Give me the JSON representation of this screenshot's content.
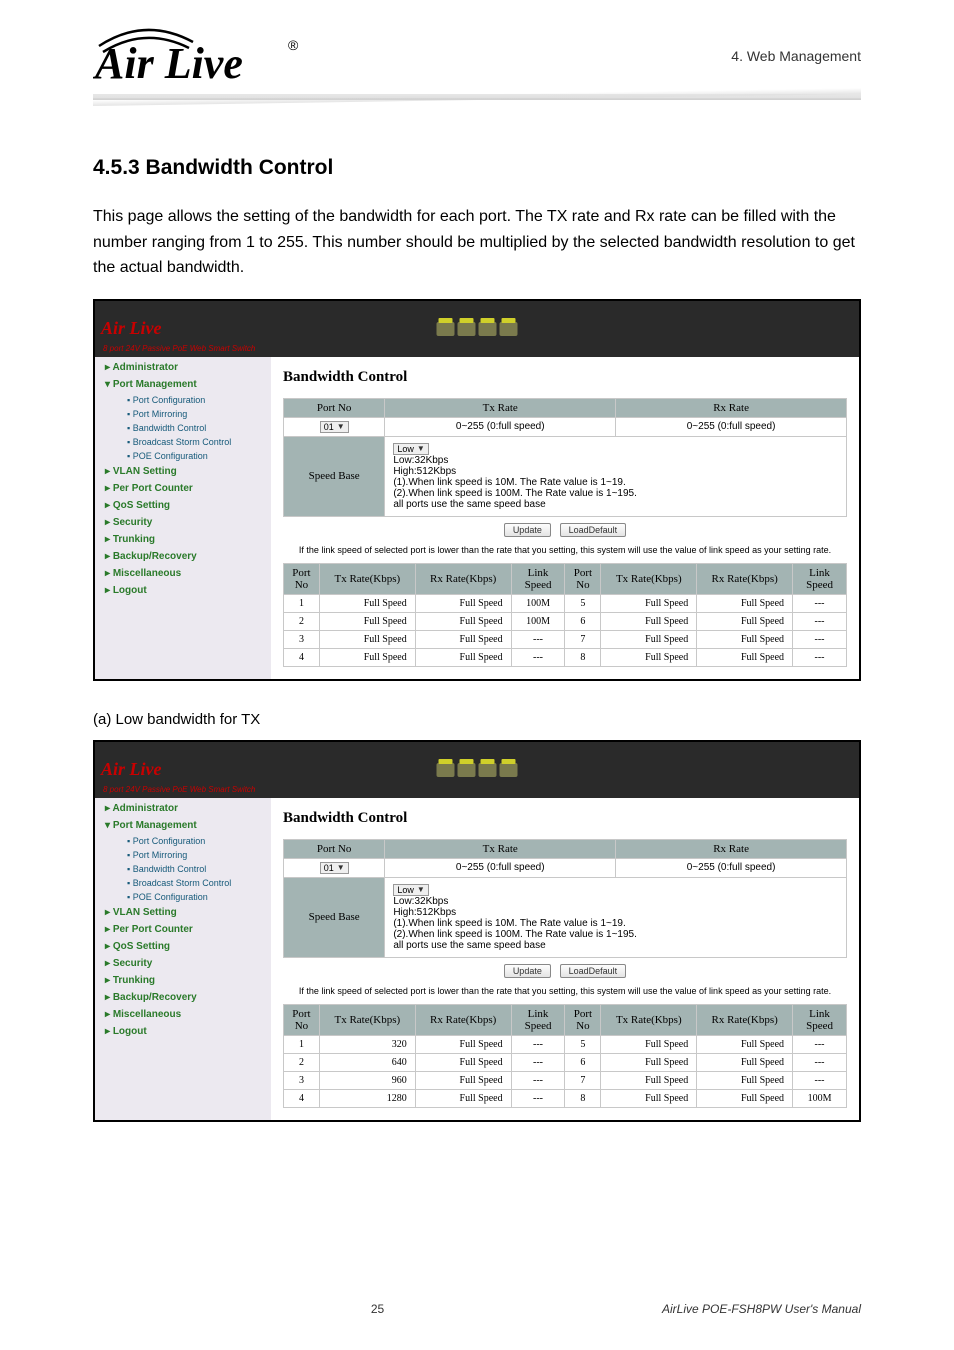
{
  "header": {
    "chapter": "4.  Web Management",
    "logo_text_air": "Air",
    "logo_text_live": "Live",
    "logo_reg": "®"
  },
  "section": {
    "number_title": "4.5.3 Bandwidth Control",
    "body": "This page allows the setting of the bandwidth for each port. The TX rate and Rx rate can be filled with the number ranging from 1 to 255. This number should be multiplied by the selected bandwidth resolution to get the actual bandwidth."
  },
  "shot_common": {
    "brand_text": "Air Live",
    "brand_sub": "8 port 24V Passive PoE Web Smart Switch",
    "panel_title": "Bandwidth Control",
    "nav": {
      "administrator": "Administrator",
      "port_management": "Port Management",
      "items": [
        "Port Configuration",
        "Port Mirroring",
        "Bandwidth Control",
        "Broadcast Storm Control",
        "POE Configuration"
      ],
      "rest": [
        "VLAN Setting",
        "Per Port Counter",
        "QoS Setting",
        "Security",
        "Trunking",
        "Backup/Recovery",
        "Miscellaneous",
        "Logout"
      ]
    },
    "config": {
      "port_no": "Port No",
      "tx_rate": "Tx Rate",
      "rx_rate": "Rx Rate",
      "port_select": "01",
      "range_text": "0~255 (0:full speed)",
      "speed_base_label": "Speed Base",
      "speed_base_select": "Low",
      "low_line": "Low:32Kbps",
      "high_line": "High:512Kbps",
      "rule1": "(1).When link speed is 10M. The Rate value is 1~19.",
      "rule2": "(2).When link speed is 100M. The Rate value is 1~195.",
      "rule3": "all ports use the same speed base",
      "btn_update": "Update",
      "btn_default": "LoadDefault",
      "note": "If the link speed of selected port is lower than the rate that you setting, this system will use the value of link speed as your setting rate."
    },
    "rates_headers": {
      "port_no": "Port No",
      "tx": "Tx Rate(Kbps)",
      "rx": "Rx Rate(Kbps)",
      "link": "Link Speed"
    }
  },
  "shot_a": {
    "rows": [
      {
        "p": "1",
        "tx": "Full Speed",
        "rx": "Full Speed",
        "ls": "100M",
        "p2": "5",
        "tx2": "Full Speed",
        "rx2": "Full Speed",
        "ls2": "---"
      },
      {
        "p": "2",
        "tx": "Full Speed",
        "rx": "Full Speed",
        "ls": "100M",
        "p2": "6",
        "tx2": "Full Speed",
        "rx2": "Full Speed",
        "ls2": "---"
      },
      {
        "p": "3",
        "tx": "Full Speed",
        "rx": "Full Speed",
        "ls": "---",
        "p2": "7",
        "tx2": "Full Speed",
        "rx2": "Full Speed",
        "ls2": "---"
      },
      {
        "p": "4",
        "tx": "Full Speed",
        "rx": "Full Speed",
        "ls": "---",
        "p2": "8",
        "tx2": "Full Speed",
        "rx2": "Full Speed",
        "ls2": "---"
      }
    ]
  },
  "caption_a": "(a)   Low bandwidth for TX",
  "shot_b": {
    "rows": [
      {
        "p": "1",
        "tx": "320",
        "rx": "Full Speed",
        "ls": "---",
        "p2": "5",
        "tx2": "Full Speed",
        "rx2": "Full Speed",
        "ls2": "---"
      },
      {
        "p": "2",
        "tx": "640",
        "rx": "Full Speed",
        "ls": "---",
        "p2": "6",
        "tx2": "Full Speed",
        "rx2": "Full Speed",
        "ls2": "---"
      },
      {
        "p": "3",
        "tx": "960",
        "rx": "Full Speed",
        "ls": "---",
        "p2": "7",
        "tx2": "Full Speed",
        "rx2": "Full Speed",
        "ls2": "---"
      },
      {
        "p": "4",
        "tx": "1280",
        "rx": "Full Speed",
        "ls": "---",
        "p2": "8",
        "tx2": "Full Speed",
        "rx2": "Full Speed",
        "ls2": "100M"
      }
    ]
  },
  "footer": {
    "page": "25",
    "manual": "AirLive POE-FSH8PW User's Manual"
  },
  "chart_data": [
    {
      "type": "table",
      "title": "Bandwidth Control — Port Rates (screenshot 1)",
      "columns": [
        "Port No",
        "Tx Rate(Kbps)",
        "Rx Rate(Kbps)",
        "Link Speed"
      ],
      "rows": [
        [
          1,
          "Full Speed",
          "Full Speed",
          "100M"
        ],
        [
          2,
          "Full Speed",
          "Full Speed",
          "100M"
        ],
        [
          3,
          "Full Speed",
          "Full Speed",
          "---"
        ],
        [
          4,
          "Full Speed",
          "Full Speed",
          "---"
        ],
        [
          5,
          "Full Speed",
          "Full Speed",
          "---"
        ],
        [
          6,
          "Full Speed",
          "Full Speed",
          "---"
        ],
        [
          7,
          "Full Speed",
          "Full Speed",
          "---"
        ],
        [
          8,
          "Full Speed",
          "Full Speed",
          "---"
        ]
      ]
    },
    {
      "type": "table",
      "title": "Bandwidth Control — Low bandwidth for TX (screenshot 2)",
      "columns": [
        "Port No",
        "Tx Rate(Kbps)",
        "Rx Rate(Kbps)",
        "Link Speed"
      ],
      "rows": [
        [
          1,
          320,
          "Full Speed",
          "---"
        ],
        [
          2,
          640,
          "Full Speed",
          "---"
        ],
        [
          3,
          960,
          "Full Speed",
          "---"
        ],
        [
          4,
          1280,
          "Full Speed",
          "---"
        ],
        [
          5,
          "Full Speed",
          "Full Speed",
          "---"
        ],
        [
          6,
          "Full Speed",
          "Full Speed",
          "---"
        ],
        [
          7,
          "Full Speed",
          "Full Speed",
          "---"
        ],
        [
          8,
          "Full Speed",
          "Full Speed",
          "100M"
        ]
      ]
    }
  ]
}
